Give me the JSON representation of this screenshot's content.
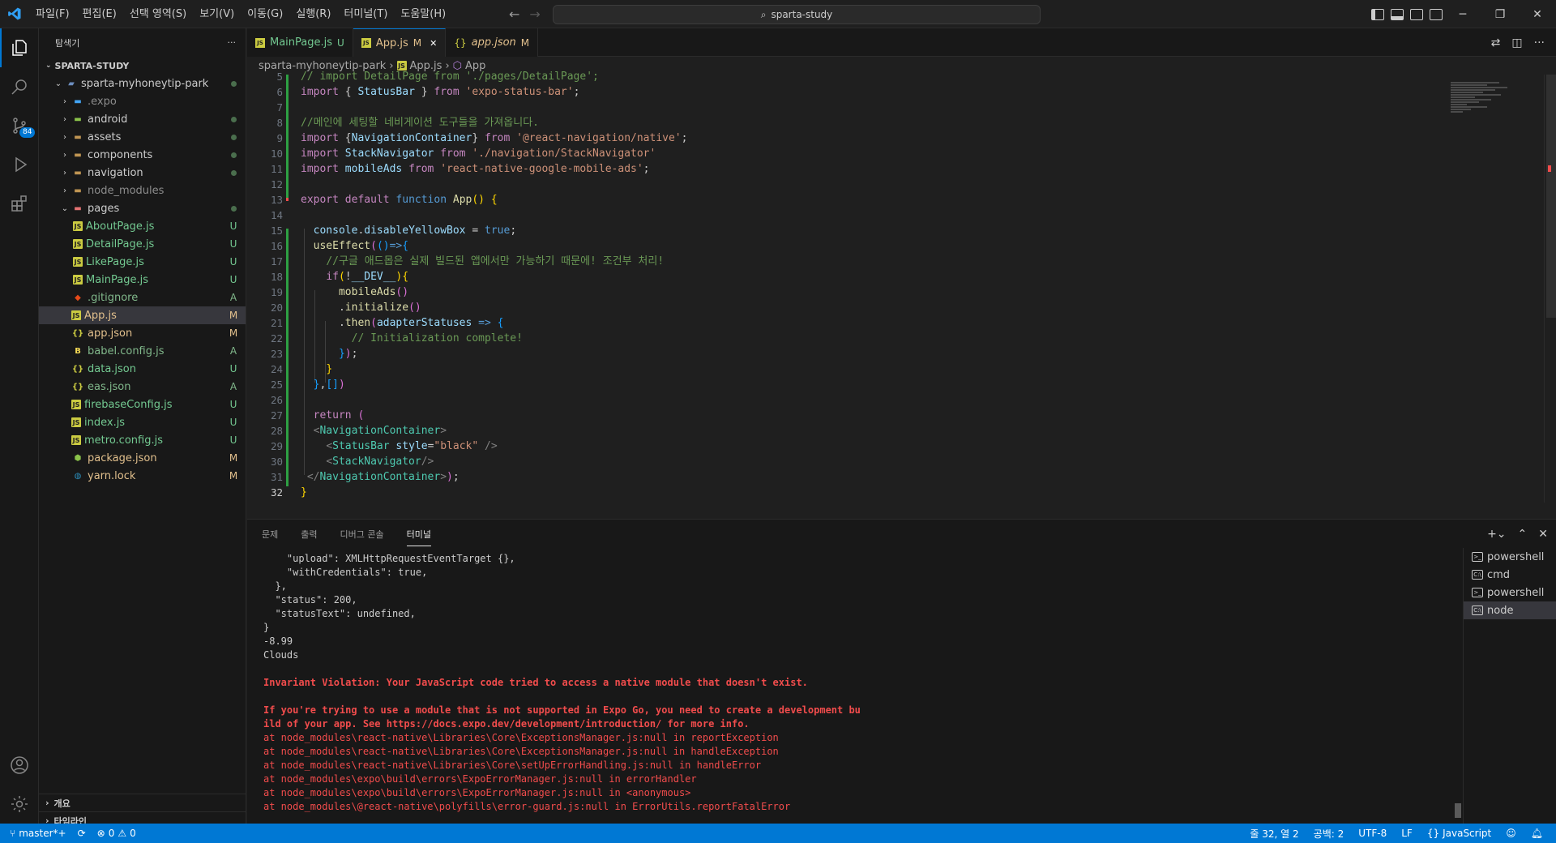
{
  "window": {
    "menu": [
      "파일(F)",
      "편집(E)",
      "선택 영역(S)",
      "보기(V)",
      "이동(G)",
      "실행(R)",
      "터미널(T)",
      "도움말(H)"
    ],
    "search": "sparta-study"
  },
  "sidebar": {
    "title": "탐색기",
    "more": "···",
    "workspace": "SPARTA-STUDY",
    "root_folder": "sparta-myhoneytip-park",
    "items": [
      {
        "label": ".expo",
        "kind": "folder",
        "status": ""
      },
      {
        "label": "android",
        "kind": "folder",
        "status": "dot"
      },
      {
        "label": "assets",
        "kind": "folder",
        "status": "dot"
      },
      {
        "label": "components",
        "kind": "folder",
        "status": "dot"
      },
      {
        "label": "navigation",
        "kind": "folder",
        "status": "dot"
      },
      {
        "label": "node_modules",
        "kind": "folder",
        "status": ""
      },
      {
        "label": "pages",
        "kind": "folder-open",
        "status": "dot"
      },
      {
        "label": "AboutPage.js",
        "kind": "js",
        "status": "U",
        "indent": 2
      },
      {
        "label": "DetailPage.js",
        "kind": "js",
        "status": "U",
        "indent": 2
      },
      {
        "label": "LikePage.js",
        "kind": "js",
        "status": "U",
        "indent": 2
      },
      {
        "label": "MainPage.js",
        "kind": "js",
        "status": "U",
        "indent": 2
      },
      {
        "label": ".gitignore",
        "kind": "git",
        "status": "A"
      },
      {
        "label": "App.js",
        "kind": "js",
        "status": "M",
        "selected": true
      },
      {
        "label": "app.json",
        "kind": "json",
        "status": "M"
      },
      {
        "label": "babel.config.js",
        "kind": "babel",
        "status": "A"
      },
      {
        "label": "data.json",
        "kind": "json",
        "status": "U"
      },
      {
        "label": "eas.json",
        "kind": "json",
        "status": "A"
      },
      {
        "label": "firebaseConfig.js",
        "kind": "js",
        "status": "U"
      },
      {
        "label": "index.js",
        "kind": "js",
        "status": "U"
      },
      {
        "label": "metro.config.js",
        "kind": "js",
        "status": "U"
      },
      {
        "label": "package.json",
        "kind": "npm",
        "status": "M"
      },
      {
        "label": "yarn.lock",
        "kind": "yarn",
        "status": "M"
      }
    ],
    "outline": "개요",
    "timeline": "타임라인"
  },
  "tabs": [
    {
      "label": "MainPage.js",
      "mod": "U",
      "active": false
    },
    {
      "label": "App.js",
      "mod": "M",
      "active": true,
      "close": "✕"
    },
    {
      "label": "app.json",
      "mod": "M",
      "active": false
    }
  ],
  "breadcrumb": {
    "folder": "sparta-myhoneytip-park",
    "file": "App.js",
    "symbol": "App"
  },
  "editor": {
    "current_line": 32,
    "lines": [
      {
        "n": "5",
        "html": "<span class='cm'>// import DetailPage from './pages/DetailPage';</span>"
      },
      {
        "n": "6",
        "html": "<span class='k'>import</span> { <span class='v'>StatusBar</span> } <span class='k'>from</span> <span class='s'>'expo-status-bar'</span>;"
      },
      {
        "n": "7",
        "html": ""
      },
      {
        "n": "8",
        "html": "<span class='cm'>//메인에 세팅할 네비게이션 도구들을 가져옵니다.</span>"
      },
      {
        "n": "9",
        "html": "<span class='k'>import</span> {<span class='v'>NavigationContainer</span>} <span class='k'>from</span> <span class='s'>'@react-navigation/native'</span>;"
      },
      {
        "n": "10",
        "html": "<span class='k'>import</span> <span class='v'>StackNavigator</span> <span class='k'>from</span> <span class='s'>'./navigation/StackNavigator'</span>"
      },
      {
        "n": "11",
        "html": "<span class='k'>import</span> <span class='v'>mobileAds</span> <span class='k'>from</span> <span class='s'>'react-native-google-mobile-ads'</span>;"
      },
      {
        "n": "12",
        "html": ""
      },
      {
        "n": "13",
        "html": "<span class='k'>export</span> <span class='k'>default</span> <span class='kb'>function</span> <span class='f'>App</span><span class='p'>()</span> <span class='p'>{</span>"
      },
      {
        "n": "14",
        "html": ""
      },
      {
        "n": "15",
        "html": "  <span class='v'>console</span>.<span class='v'>disableYellowBox</span> = <span class='kb'>true</span>;"
      },
      {
        "n": "16",
        "html": "  <span class='f'>useEffect</span><span class='p2'>(</span><span class='p3'>()</span><span class='kb'>=&gt;</span><span class='p3'>{</span>"
      },
      {
        "n": "17",
        "html": "    <span class='cm'>//구글 애드몹은 실제 빌드된 앱에서만 가능하기 때문에! 조건부 처리!</span>"
      },
      {
        "n": "18",
        "html": "    <span class='k'>if</span><span class='p'>(</span>!<span class='v'>__DEV__</span><span class='p'>)</span><span class='p'>{</span>"
      },
      {
        "n": "19",
        "html": "      <span class='f'>mobileAds</span><span class='p2'>()</span>"
      },
      {
        "n": "20",
        "html": "      .<span class='f'>initialize</span><span class='p2'>()</span>"
      },
      {
        "n": "21",
        "html": "      .<span class='f'>then</span><span class='p2'>(</span><span class='v'>adapterStatuses</span> <span class='kb'>=&gt;</span> <span class='p3'>{</span>"
      },
      {
        "n": "22",
        "html": "        <span class='cm'>// Initialization complete!</span>"
      },
      {
        "n": "23",
        "html": "      <span class='p3'>}</span><span class='p2'>)</span>;"
      },
      {
        "n": "24",
        "html": "    <span class='p'>}</span>"
      },
      {
        "n": "25",
        "html": "  <span class='p3'>}</span>,<span class='p3'>[]</span><span class='p2'>)</span>"
      },
      {
        "n": "26",
        "html": ""
      },
      {
        "n": "27",
        "html": "  <span class='k'>return</span> <span class='p2'>(</span>"
      },
      {
        "n": "28",
        "html": "  <span class='tg'>&lt;</span><span class='cmp'>NavigationContainer</span><span class='tg'>&gt;</span>"
      },
      {
        "n": "29",
        "html": "    <span class='tg'>&lt;</span><span class='cmp'>StatusBar</span> <span class='at'>style</span>=<span class='s'>\"black\"</span> <span class='tg'>/&gt;</span>"
      },
      {
        "n": "30",
        "html": "    <span class='tg'>&lt;</span><span class='cmp'>StackNavigator</span><span class='tg'>/&gt;</span>"
      },
      {
        "n": "31",
        "html": " <span class='tg'>&lt;/</span><span class='cmp'>NavigationContainer</span><span class='tg'>&gt;</span><span class='p2'>)</span>;"
      },
      {
        "n": "32",
        "html": "<span class='p'>}</span>"
      }
    ]
  },
  "panel": {
    "tabs": [
      "문제",
      "출력",
      "디버그 콘솔",
      "터미널"
    ],
    "active_tab": "터미널",
    "terminal_lines": [
      {
        "t": "    \"upload\": XMLHttpRequestEventTarget {},",
        "c": ""
      },
      {
        "t": "    \"withCredentials\": true,",
        "c": ""
      },
      {
        "t": "  },",
        "c": ""
      },
      {
        "t": "  \"status\": 200,",
        "c": ""
      },
      {
        "t": "  \"statusText\": undefined,",
        "c": ""
      },
      {
        "t": "}",
        "c": ""
      },
      {
        "t": "-8.99",
        "c": ""
      },
      {
        "t": "Clouds",
        "c": ""
      },
      {
        "t": "",
        "c": ""
      },
      {
        "t": "Invariant Violation: Your JavaScript code tried to access a native module that doesn't exist.",
        "c": "err"
      },
      {
        "t": "",
        "c": ""
      },
      {
        "t": "If you're trying to use a module that is not supported in Expo Go, you need to create a development bu",
        "c": "err"
      },
      {
        "t": "ild of your app. See https://docs.expo.dev/development/introduction/ for more info.",
        "c": "err"
      },
      {
        "t": "at node_modules\\react-native\\Libraries\\Core\\ExceptionsManager.js:null in reportException",
        "c": "err2"
      },
      {
        "t": "at node_modules\\react-native\\Libraries\\Core\\ExceptionsManager.js:null in handleException",
        "c": "err2"
      },
      {
        "t": "at node_modules\\react-native\\Libraries\\Core\\setUpErrorHandling.js:null in handleError",
        "c": "err2"
      },
      {
        "t": "at node_modules\\expo\\build\\errors\\ExpoErrorManager.js:null in errorHandler",
        "c": "err2"
      },
      {
        "t": "at node_modules\\expo\\build\\errors\\ExpoErrorManager.js:null in <anonymous>",
        "c": "err2"
      },
      {
        "t": "at node_modules\\@react-native\\polyfills\\error-guard.js:null in ErrorUtils.reportFatalError",
        "c": "err2"
      }
    ],
    "terminals": [
      {
        "label": "powershell",
        "icon": "ps",
        "active": false
      },
      {
        "label": "cmd",
        "icon": "cmd",
        "active": false
      },
      {
        "label": "powershell",
        "icon": "ps",
        "active": false
      },
      {
        "label": "node",
        "icon": "cmd",
        "active": true
      }
    ]
  },
  "statusbar": {
    "branch": "master*+",
    "errors": "0",
    "warnings": "0",
    "position": "줄 32, 열 2",
    "spaces": "공백: 2",
    "encoding": "UTF-8",
    "eol": "LF",
    "language": "JavaScript"
  },
  "badges": {
    "source_control": "84"
  },
  "colors": {
    "accent": "#0078d4",
    "statusbar": "#0078d4",
    "error": "#f14c4c"
  }
}
